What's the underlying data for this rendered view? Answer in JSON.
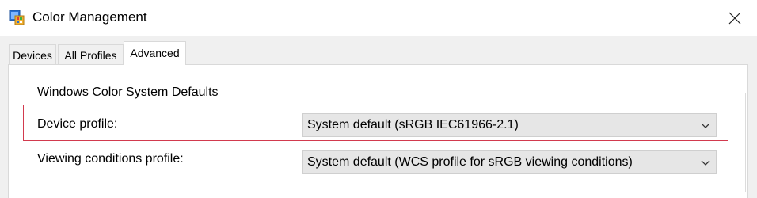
{
  "window": {
    "title": "Color Management",
    "icon": "color-management-icon",
    "close_icon": "close-icon"
  },
  "tabs": [
    {
      "label": "Devices",
      "active": false
    },
    {
      "label": "All Profiles",
      "active": false
    },
    {
      "label": "Advanced",
      "active": true
    }
  ],
  "advanced": {
    "group_title": "Windows Color System Defaults",
    "device_profile": {
      "label": "Device profile:",
      "value": "System default (sRGB IEC61966-2.1)"
    },
    "viewing_conditions_profile": {
      "label": "Viewing conditions profile:",
      "value": "System default (WCS profile for sRGB viewing conditions)"
    }
  },
  "colors": {
    "highlight_border": "#d23a4e",
    "combo_background": "#e6e6e6"
  }
}
